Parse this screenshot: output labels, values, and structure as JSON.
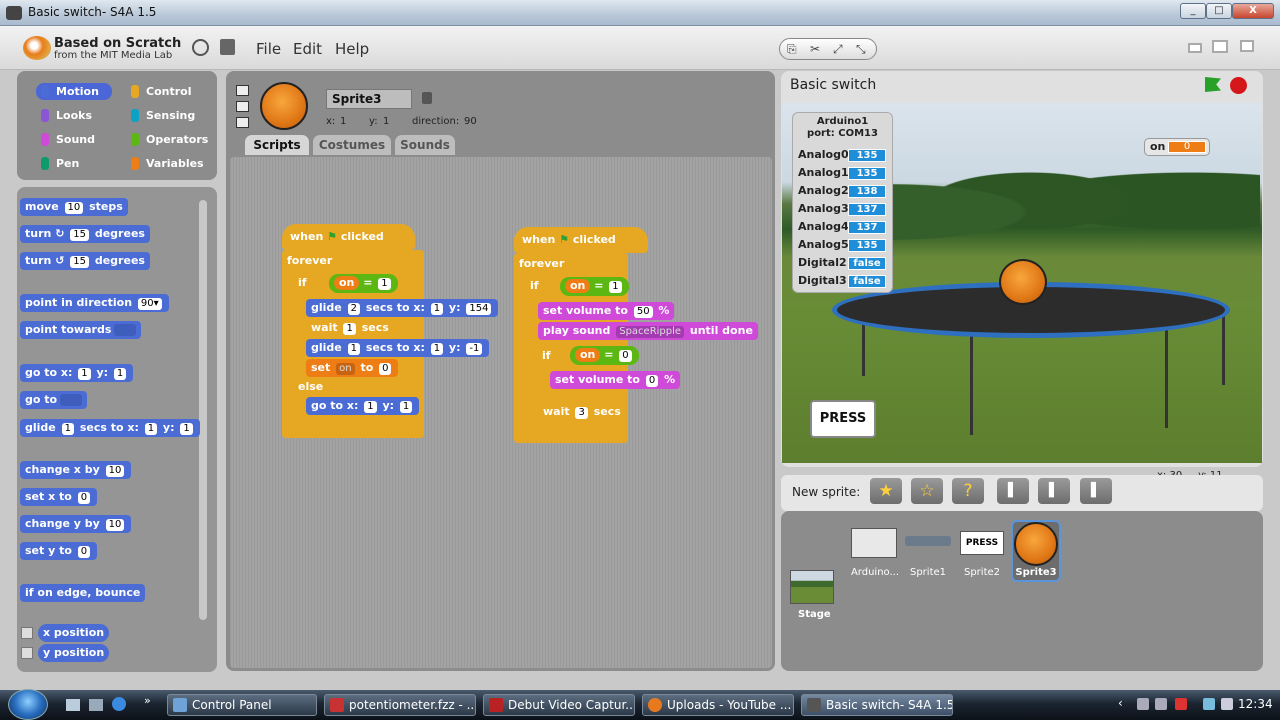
{
  "window": {
    "title": "Basic switch- S4A 1.5",
    "buttons": [
      "_",
      "□",
      "X"
    ]
  },
  "menubar": {
    "logo_title": "Based on Scratch",
    "logo_sub": "from the MIT Media Lab",
    "items": [
      "File",
      "Edit",
      "Help"
    ]
  },
  "categories": [
    {
      "label": "Motion",
      "color": "#4a6cd4"
    },
    {
      "label": "Control",
      "color": "#e6a822"
    },
    {
      "label": "Looks",
      "color": "#8a55d7"
    },
    {
      "label": "Sensing",
      "color": "#0aa2c6"
    },
    {
      "label": "Sound",
      "color": "#cf4ad9"
    },
    {
      "label": "Operators",
      "color": "#5cb712"
    },
    {
      "label": "Pen",
      "color": "#0e9a6c"
    },
    {
      "label": "Variables",
      "color": "#ee7d16"
    }
  ],
  "palette": {
    "move": {
      "a": "move",
      "v": "10",
      "b": "steps"
    },
    "turn_cw": {
      "a": "turn",
      "v": "15",
      "b": "degrees"
    },
    "turn_ccw": {
      "a": "turn",
      "v": "15",
      "b": "degrees"
    },
    "point_dir": {
      "a": "point in direction",
      "v": "90▾"
    },
    "point_towards": {
      "a": "point towards"
    },
    "goto_xy": {
      "a": "go to x:",
      "v1": "1",
      "b": "y:",
      "v2": "1"
    },
    "goto": {
      "a": "go to"
    },
    "glide": {
      "a": "glide",
      "v1": "1",
      "b": "secs to x:",
      "v2": "1",
      "c": "y:",
      "v3": "1"
    },
    "change_x": {
      "a": "change x by",
      "v": "10"
    },
    "set_x": {
      "a": "set x to",
      "v": "0"
    },
    "change_y": {
      "a": "change y by",
      "v": "10"
    },
    "set_y": {
      "a": "set y to",
      "v": "0"
    },
    "bounce": "if on edge, bounce",
    "xpos": "x position",
    "ypos": "y position"
  },
  "sprite": {
    "name": "Sprite3",
    "x_label": "x:",
    "x": "1",
    "y_label": "y:",
    "y": "1",
    "dir_label": "direction:",
    "dir": "90"
  },
  "tabs": [
    "Scripts",
    "Costumes",
    "Sounds"
  ],
  "script1": {
    "hat_a": "when",
    "hat_b": "clicked",
    "forever": "forever",
    "if": "if",
    "var": "on",
    "eq": "=",
    "val": "1",
    "glide1": {
      "a": "glide",
      "v1": "2",
      "b": "secs to x:",
      "v2": "1",
      "c": "y:",
      "v3": "154"
    },
    "wait": {
      "a": "wait",
      "v": "1",
      "b": "secs"
    },
    "glide2": {
      "a": "glide",
      "v1": "1",
      "b": "secs to x:",
      "v2": "1",
      "c": "y:",
      "v3": "-1"
    },
    "set": {
      "a": "set",
      "var": "on",
      "b": "to",
      "v": "0"
    },
    "else": "else",
    "goto": {
      "a": "go to x:",
      "v1": "1",
      "b": "y:",
      "v2": "1"
    }
  },
  "script2": {
    "hat_a": "when",
    "hat_b": "clicked",
    "forever": "forever",
    "if": "if",
    "var": "on",
    "eq": "=",
    "val": "1",
    "setvol1": {
      "a": "set volume to",
      "v": "50",
      "b": "%"
    },
    "play": {
      "a": "play sound",
      "v": "SpaceRipple",
      "b": "until done"
    },
    "if2": "if",
    "var2": "on",
    "eq2": "=",
    "val2": "0",
    "setvol2": {
      "a": "set volume to",
      "v": "0",
      "b": "%"
    },
    "wait": {
      "a": "wait",
      "v": "3",
      "b": "secs"
    }
  },
  "stage": {
    "title": "Basic switch",
    "arduino_title": "Arduino1",
    "arduino_port": "port: COM13",
    "sensors": [
      {
        "label": "Analog0",
        "value": "135"
      },
      {
        "label": "Analog1",
        "value": "135"
      },
      {
        "label": "Analog2",
        "value": "138"
      },
      {
        "label": "Analog3",
        "value": "137"
      },
      {
        "label": "Analog4",
        "value": "137"
      },
      {
        "label": "Analog5",
        "value": "135"
      },
      {
        "label": "Digital2",
        "value": "false"
      },
      {
        "label": "Digital3",
        "value": "false"
      }
    ],
    "on_monitor": {
      "label": "on",
      "value": "0"
    },
    "press": "PRESS",
    "mouse_x": "x: 30",
    "mouse_y": "y: 11"
  },
  "new_sprite": {
    "label": "New sprite:"
  },
  "sprites": [
    {
      "name": "Arduino..."
    },
    {
      "name": "Sprite1"
    },
    {
      "name": "Sprite2",
      "thumb": "PRESS"
    },
    {
      "name": "Sprite3"
    }
  ],
  "stage_thumb": {
    "label": "Stage"
  },
  "taskbar": {
    "items": [
      "Control Panel",
      "potentiometer.fzz - ...",
      "Debut Video Captur...",
      "Uploads - YouTube ...",
      "Basic switch- S4A 1.5"
    ],
    "clock": "12:34"
  }
}
